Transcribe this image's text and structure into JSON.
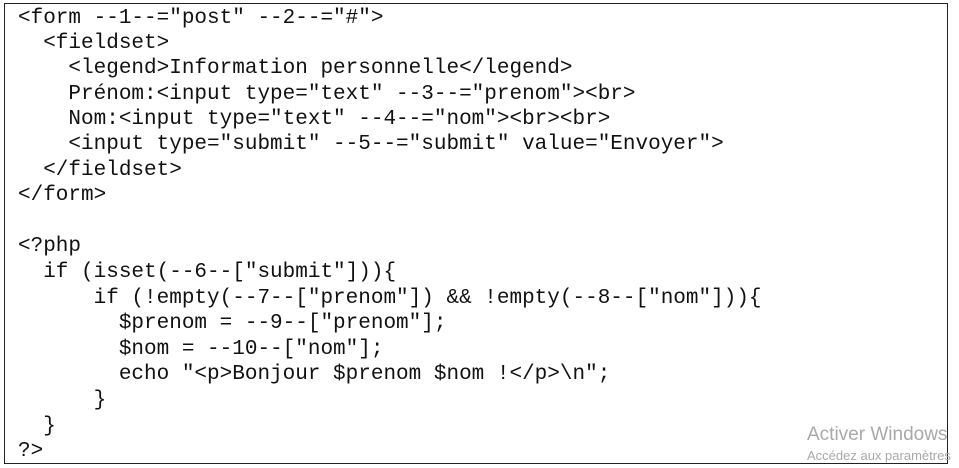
{
  "code": {
    "lines": [
      "<form --1--=\"post\" --2--=\"#\">",
      "  <fieldset>",
      "    <legend>Information personnelle</legend>",
      "    Prénom:<input type=\"text\" --3--=\"prenom\"><br>",
      "    Nom:<input type=\"text\" --4--=\"nom\"><br><br>",
      "    <input type=\"submit\" --5--=\"submit\" value=\"Envoyer\">",
      "  </fieldset>",
      "</form>",
      "",
      "<?php",
      "  if (isset(--6--[\"submit\"])){",
      "      if (!empty(--7--[\"prenom\"]) && !empty(--8--[\"nom\"])){",
      "        $prenom = --9--[\"prenom\"];",
      "        $nom = --10--[\"nom\"];",
      "        echo \"<p>Bonjour $prenom $nom !</p>\\n\";",
      "      }",
      "  }",
      "?>"
    ]
  },
  "watermark": {
    "title": "Activer Windows",
    "subtitle": "Accédez aux paramètres"
  },
  "colors": {
    "text": "#111111",
    "border": "#222222",
    "watermark": "#a9a9a9"
  }
}
